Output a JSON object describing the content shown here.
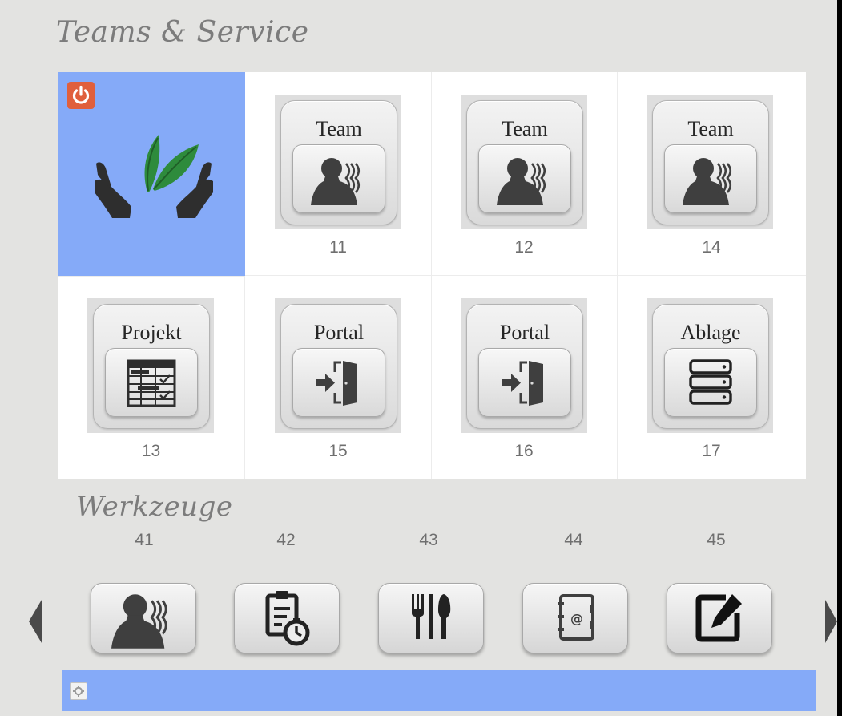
{
  "sections": {
    "teams_title": "Teams & Service",
    "tools_title": "Werkzeuge"
  },
  "grid": [
    {
      "type": "logo",
      "selected": true,
      "icon": "hands-leaf-icon",
      "power_icon": "power-icon"
    },
    {
      "type": "tile",
      "label": "Team",
      "number": "11",
      "icon": "team-person-icon"
    },
    {
      "type": "tile",
      "label": "Team",
      "number": "12",
      "icon": "team-person-icon"
    },
    {
      "type": "tile",
      "label": "Team",
      "number": "14",
      "icon": "team-person-icon"
    },
    {
      "type": "tile",
      "label": "Projekt",
      "number": "13",
      "icon": "project-table-icon"
    },
    {
      "type": "tile",
      "label": "Portal",
      "number": "15",
      "icon": "portal-door-icon"
    },
    {
      "type": "tile",
      "label": "Portal",
      "number": "16",
      "icon": "portal-door-icon"
    },
    {
      "type": "tile",
      "label": "Ablage",
      "number": "17",
      "icon": "storage-stack-icon"
    }
  ],
  "tools": [
    {
      "number": "41",
      "icon": "team-person-icon"
    },
    {
      "number": "42",
      "icon": "clipboard-timer-icon"
    },
    {
      "number": "43",
      "icon": "cutlery-icon"
    },
    {
      "number": "44",
      "icon": "address-book-icon"
    },
    {
      "number": "45",
      "icon": "edit-note-icon"
    }
  ],
  "colors": {
    "background": "#e3e3e1",
    "selected": "#85aaf8",
    "power": "#e05f3c",
    "leaf": "#2e8b3c",
    "icon_dark": "#3f3f3f"
  }
}
